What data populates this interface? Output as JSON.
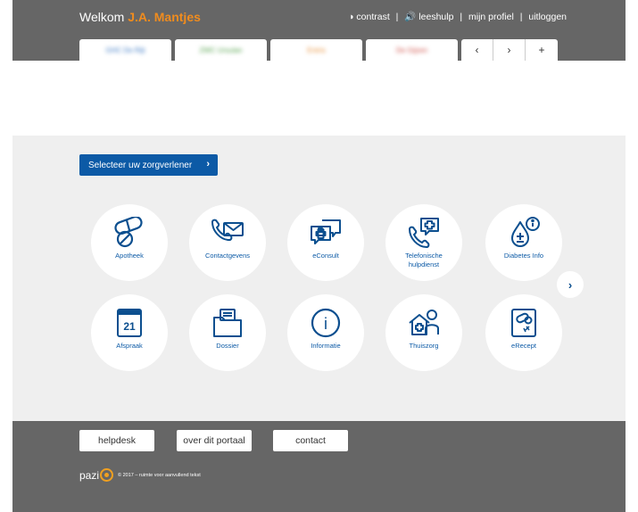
{
  "header": {
    "welcome": "Welkom",
    "user_name": "J.A. Mantjes",
    "links": {
      "contrast": "◑ contrast",
      "leeshulp": "🔊 leeshulp",
      "profiel": "mijn profiel",
      "uitloggen": "uitloggen",
      "separator": "|"
    },
    "tabs": [
      {
        "label": "GHC De Rijt",
        "color": "#3b78c4"
      },
      {
        "label": "ZWC Ursulan",
        "color": "#52a04a"
      },
      {
        "label": "Entris",
        "color": "#e8903a"
      },
      {
        "label": "De Gijzen",
        "color": "#cf5048"
      }
    ],
    "tab_nav": {
      "prev": "‹",
      "next": "›",
      "add": "+"
    }
  },
  "main": {
    "select_button": "Selecteer uw zorgverlener",
    "select_chevron": "›",
    "next_button": "›",
    "tiles": [
      {
        "label": "Apotheek",
        "icon": "pills-icon"
      },
      {
        "label": "Contactgevens",
        "icon": "phone-envelope-icon"
      },
      {
        "label": "eConsult",
        "icon": "chat-medical-icon"
      },
      {
        "label": "Telefonische hulpdienst",
        "icon": "phone-medical-icon"
      },
      {
        "label": "Diabetes Info",
        "icon": "drop-info-icon"
      },
      {
        "label": "Afspraak",
        "icon": "calendar-icon",
        "day": "21"
      },
      {
        "label": "Dossier",
        "icon": "folder-icon"
      },
      {
        "label": "Informatie",
        "icon": "info-icon",
        "glyph": "i"
      },
      {
        "label": "Thuiszorg",
        "icon": "home-care-icon"
      },
      {
        "label": "eRecept",
        "icon": "prescription-icon"
      }
    ]
  },
  "footer": {
    "buttons": [
      "helpdesk",
      "over dit portaal",
      "contact"
    ],
    "logo": "pazi",
    "copyright": "© 2017 – ruimte voor aanvullend tekst"
  },
  "colors": {
    "header_bg": "#666666",
    "main_bg": "#efefef",
    "accent_blue": "#0c5aa6",
    "accent_orange": "#f08c1e"
  }
}
